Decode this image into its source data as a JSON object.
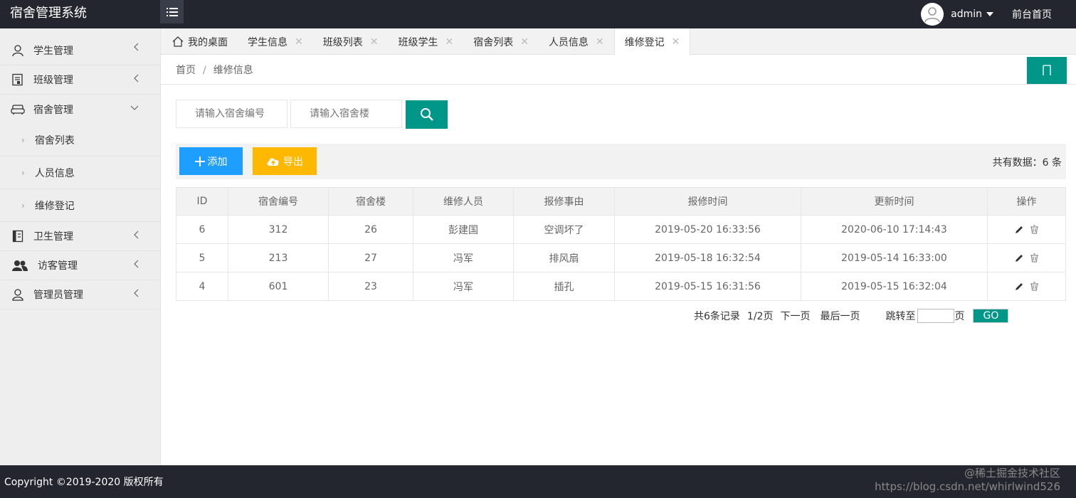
{
  "header": {
    "app_title": "宿舍管理系统",
    "username": "admin",
    "front_link": "前台首页"
  },
  "sidebar": {
    "items": [
      {
        "label": "学生管理",
        "icon": "user-icon"
      },
      {
        "label": "班级管理",
        "icon": "calendar-icon"
      },
      {
        "label": "宿舍管理",
        "icon": "sofa-icon",
        "expanded": true
      },
      {
        "label": "卫生管理",
        "icon": "document-icon"
      },
      {
        "label": "访客管理",
        "icon": "group-icon"
      },
      {
        "label": "管理员管理",
        "icon": "admin-user-icon"
      }
    ],
    "subitems": [
      "宿舍列表",
      "人员信息",
      "维修登记"
    ]
  },
  "tabs": [
    {
      "label": "我的桌面",
      "closable": false
    },
    {
      "label": "学生信息",
      "closable": true
    },
    {
      "label": "班级列表",
      "closable": true
    },
    {
      "label": "班级学生",
      "closable": true
    },
    {
      "label": "宿舍列表",
      "closable": true
    },
    {
      "label": "人员信息",
      "closable": true
    },
    {
      "label": "维修登记",
      "closable": true,
      "active": true
    }
  ],
  "breadcrumb": {
    "home": "首页",
    "separator": "/",
    "current": "维修信息"
  },
  "search": {
    "dorm_number_placeholder": "请输入宿舍编号",
    "building_placeholder": "请输入宿舍楼"
  },
  "toolbar": {
    "add_label": "添加",
    "export_label": "导出",
    "total_text": "共有数据：6 条"
  },
  "table": {
    "headers": [
      "ID",
      "宿舍编号",
      "宿舍楼",
      "维修人员",
      "报修事由",
      "报修时间",
      "更新时间",
      "操作"
    ],
    "rows": [
      [
        "6",
        "312",
        "26",
        "彭建国",
        "空调坏了",
        "2019-05-20 16:33:56",
        "2020-06-10 17:14:43"
      ],
      [
        "5",
        "213",
        "27",
        "冯军",
        "排风扇",
        "2019-05-18 16:32:54",
        "2019-05-14 16:33:00"
      ],
      [
        "4",
        "601",
        "23",
        "冯军",
        "插孔",
        "2019-05-15 16:31:56",
        "2019-05-15 16:32:04"
      ]
    ]
  },
  "pager": {
    "total_records": "共6条记录",
    "page_info": "1/2页",
    "next": "下一页",
    "last": "最后一页",
    "jump_to": "跳转至",
    "page_unit": "页",
    "go": "GO"
  },
  "footer": {
    "copyright": "Copyright ©2019-2020 版权所有",
    "watermark_line1": "@稀土掘金技术社区",
    "watermark_line2": "https://blog.csdn.net/whirlwind526"
  },
  "colors": {
    "header_bg": "#23262e",
    "primary_green": "#009688",
    "blue_button": "#1e9fff",
    "orange_button": "#ffb800"
  }
}
